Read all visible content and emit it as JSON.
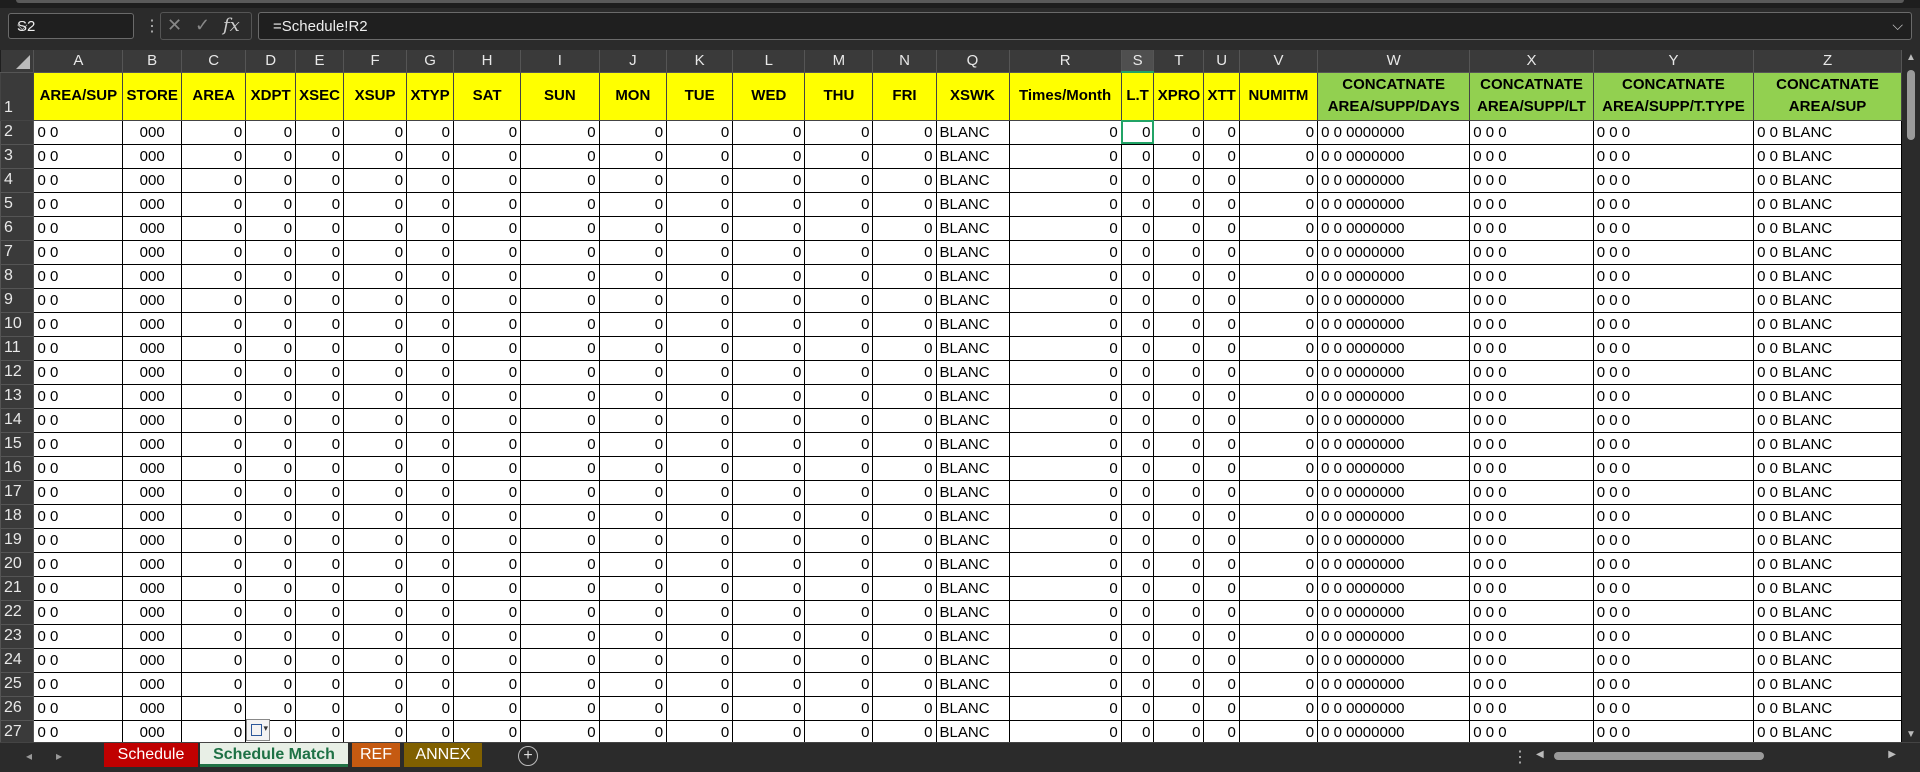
{
  "formula_bar": {
    "name_box": "S2",
    "fx_label": "fx",
    "formula": "=Schedule!R2"
  },
  "columns": [
    "A",
    "B",
    "C",
    "D",
    "E",
    "F",
    "G",
    "H",
    "I",
    "J",
    "K",
    "L",
    "M",
    "N",
    "Q",
    "R",
    "S",
    "T",
    "U",
    "V",
    "W",
    "X",
    "Y",
    "Z"
  ],
  "selected_column": "S",
  "header_row": {
    "row_number": "1",
    "cells": [
      "AREA/SUP",
      "STORE",
      "AREA",
      "XDPT",
      "XSEC",
      "XSUP",
      "XTYP",
      "SAT",
      "SUN",
      "MON",
      "TUE",
      "WED",
      "THU",
      "FRI",
      "XSWK",
      "Times/Month",
      "L.T",
      "XPRO",
      "XTT",
      "NUMITM",
      "CONCATNATE AREA/SUPP/DAYS",
      "CONCATNATE AREA/SUPP/LT",
      "CONCATNATE AREA/SUPP/T.TYPE",
      "CONCATNATE AREA/SUP"
    ],
    "fill_colors": {
      "yellow": "#ffff00",
      "green": "#92d050"
    }
  },
  "row_template": {
    "cells": [
      "0 0",
      "000",
      "0",
      "0",
      "0",
      "0",
      "0",
      "0",
      "0",
      "0",
      "0",
      "0",
      "0",
      "0",
      "BLANC",
      "0",
      "0",
      "0",
      "0",
      "0",
      "0 0 0000000",
      "0 0 0",
      "0 0 0",
      "0 0 BLANC"
    ]
  },
  "row_numbers": [
    "2",
    "3",
    "4",
    "5",
    "6",
    "7",
    "8",
    "9",
    "10",
    "11",
    "12",
    "13",
    "14",
    "15",
    "16",
    "17",
    "18",
    "19",
    "20",
    "21",
    "22",
    "23",
    "24",
    "25",
    "26",
    "27"
  ],
  "active_cell": {
    "row": "2",
    "column": "S"
  },
  "sheet_tabs": [
    {
      "label": "Schedule",
      "color": "#c00000"
    },
    {
      "label": "Schedule Match",
      "color": "#217346",
      "active": true
    },
    {
      "label": "REF",
      "color": "#c55a11"
    },
    {
      "label": "ANNEX",
      "color": "#806000"
    }
  ]
}
